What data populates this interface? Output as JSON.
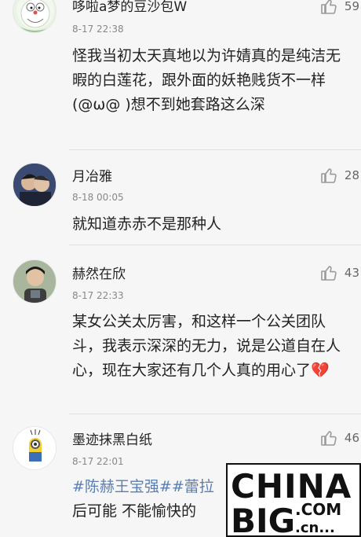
{
  "comments": [
    {
      "name": "哆啦a梦的豆沙包W",
      "time": "8-17 22:38",
      "likes": "59",
      "text": "怪我当初太天真地以为许婧真的是纯洁无暇的白莲花，跟外面的妖艳贱货不一样(@ω@ )想不到她套路这么深",
      "avatar_icon": "doraemon-icon"
    },
    {
      "name": "月冶雅",
      "time": "8-18 00:05",
      "likes": "28",
      "text": "就知道赤赤不是那种人",
      "avatar_icon": "couple-photo-icon"
    },
    {
      "name": "赫然在欣",
      "time": "8-17 22:33",
      "likes": "43",
      "text": "某女公关太厉害，和这样一个公关团队斗，我表示深深的无力，说是公道自在人心，现在大家还有几个人真的用心了",
      "text_emoji": "💔",
      "avatar_icon": "person-photo-icon"
    },
    {
      "name": "墨迹抹黑白纸",
      "time": "8-17 22:01",
      "likes": "46",
      "hashtags": "#陈赫王宝强##蕾拉",
      "text": "后可能 不能愉快的",
      "avatar_icon": "minion-icon"
    }
  ],
  "watermark": {
    "line1": "CHINA",
    "line2": "BIG",
    "suffix_top": ".COM",
    "suffix_bottom": ".cn..."
  },
  "colors": {
    "background": "#f6f6f6",
    "hashtag": "#5b7fb1",
    "heart": "#d9344a"
  }
}
